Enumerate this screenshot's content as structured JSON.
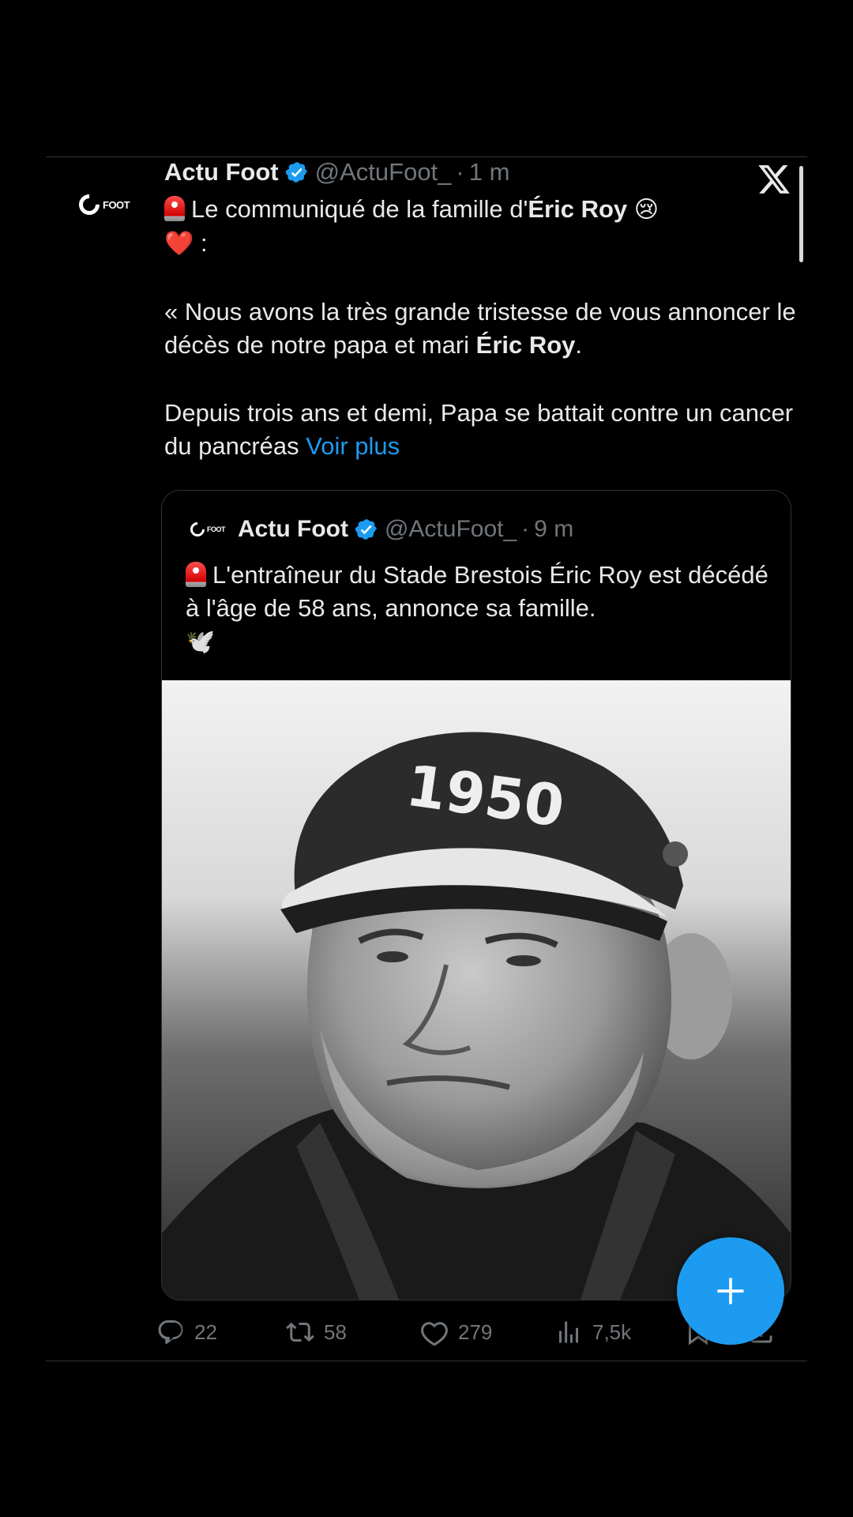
{
  "avatar": {
    "logo_text": "FOOT"
  },
  "tweet": {
    "name": "Actu Foot",
    "handle": "@ActuFoot_",
    "separator": "·",
    "time": "1 m",
    "line1_pre": "Le communiqué de la famille d'",
    "line1_bold": "Éric Roy",
    "line1_emoji": "😢",
    "line2_emoji": "❤️",
    "line2_colon": " :",
    "para2_pre": "« Nous avons la très grande tristesse de vous annoncer le décès de notre papa et mari ",
    "para2_bold": "Éric Roy",
    "para2_post": ".",
    "para3": "Depuis trois ans et demi, Papa se battait contre un cancer du pancréas ",
    "see_more": "Voir plus"
  },
  "quote": {
    "logo_text": "FOOT",
    "name": "Actu Foot",
    "handle": "@ActuFoot_",
    "separator": "·",
    "time": "9 m",
    "text": "L'entraîneur du Stade Brestois Éric Roy est décédé à l'âge de 58 ans, annonce sa famille.",
    "emoji": "🕊️",
    "cap_text": "1950"
  },
  "actions": {
    "replies": "22",
    "reposts": "58",
    "likes": "279",
    "views": "7,5k"
  },
  "colors": {
    "background": "#000000",
    "accent": "#1d9bf0",
    "secondary_text": "#71767b",
    "primary_text": "#e7e9ea"
  },
  "icons": [
    "x-logo-icon",
    "verified-badge-icon",
    "siren-icon",
    "reply-icon",
    "repost-icon",
    "like-icon",
    "views-icon",
    "bookmark-icon",
    "share-icon",
    "compose-plus-icon"
  ]
}
